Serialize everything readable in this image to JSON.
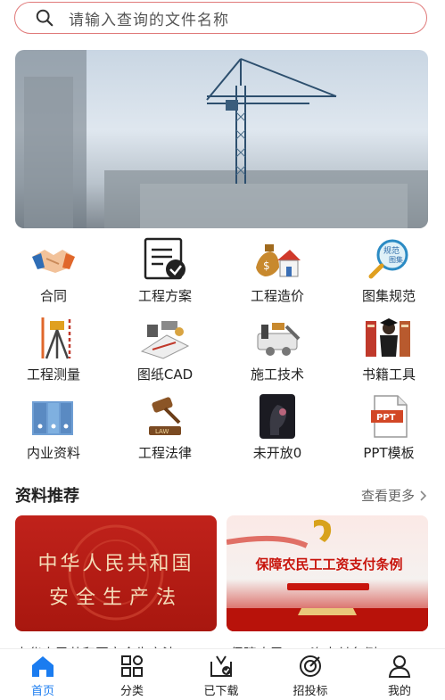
{
  "search": {
    "placeholder": "请输入查询的文件名称"
  },
  "categories": [
    {
      "label": "合同",
      "icon": "handshake-icon"
    },
    {
      "label": "工程方案",
      "icon": "document-check-icon"
    },
    {
      "label": "工程造价",
      "icon": "money-house-icon"
    },
    {
      "label": "图集规范",
      "icon": "magnifier-atlas-icon"
    },
    {
      "label": "工程测量",
      "icon": "surveying-tripod-icon"
    },
    {
      "label": "图纸CAD",
      "icon": "drawing-tools-icon"
    },
    {
      "label": "施工技术",
      "icon": "construction-tools-icon"
    },
    {
      "label": "书籍工具",
      "icon": "books-graduate-icon"
    },
    {
      "label": "内业资料",
      "icon": "binder-files-icon"
    },
    {
      "label": "工程法律",
      "icon": "law-gavel-icon"
    },
    {
      "label": "未开放0",
      "icon": "locked-head-icon"
    },
    {
      "label": "PPT模板",
      "icon": "ppt-file-icon"
    }
  ],
  "section": {
    "title": "资料推荐",
    "more": "查看更多"
  },
  "cards": [
    {
      "line1": "中华人民共和国",
      "line2": "安全生产法",
      "caption": "中华人民共和国安全生产法"
    },
    {
      "headline": "保障农民工工资支付条例",
      "caption": "保障农民工工资支付条例"
    }
  ],
  "tabs": [
    {
      "label": "首页",
      "active": true
    },
    {
      "label": "分类"
    },
    {
      "label": "已下载"
    },
    {
      "label": "招投标"
    },
    {
      "label": "我的"
    }
  ],
  "colors": {
    "accent": "#1a7cf0",
    "search_border": "#e07a7a",
    "card_red": "#c0221b"
  }
}
